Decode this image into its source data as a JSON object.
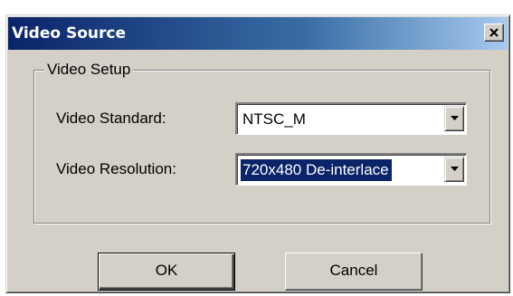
{
  "window": {
    "title": "Video Source",
    "close_symbol": "close-icon"
  },
  "group": {
    "label": "Video Setup"
  },
  "fields": {
    "standard": {
      "label": "Video Standard:",
      "value": "NTSC_M"
    },
    "resolution": {
      "label": "Video Resolution:",
      "value": "720x480 De-interlace"
    }
  },
  "buttons": {
    "ok": "OK",
    "cancel": "Cancel"
  },
  "colors": {
    "titlebar_start": "#0a246a",
    "titlebar_end": "#a6caf0",
    "face": "#d4d0c8",
    "selection": "#0a246a"
  }
}
